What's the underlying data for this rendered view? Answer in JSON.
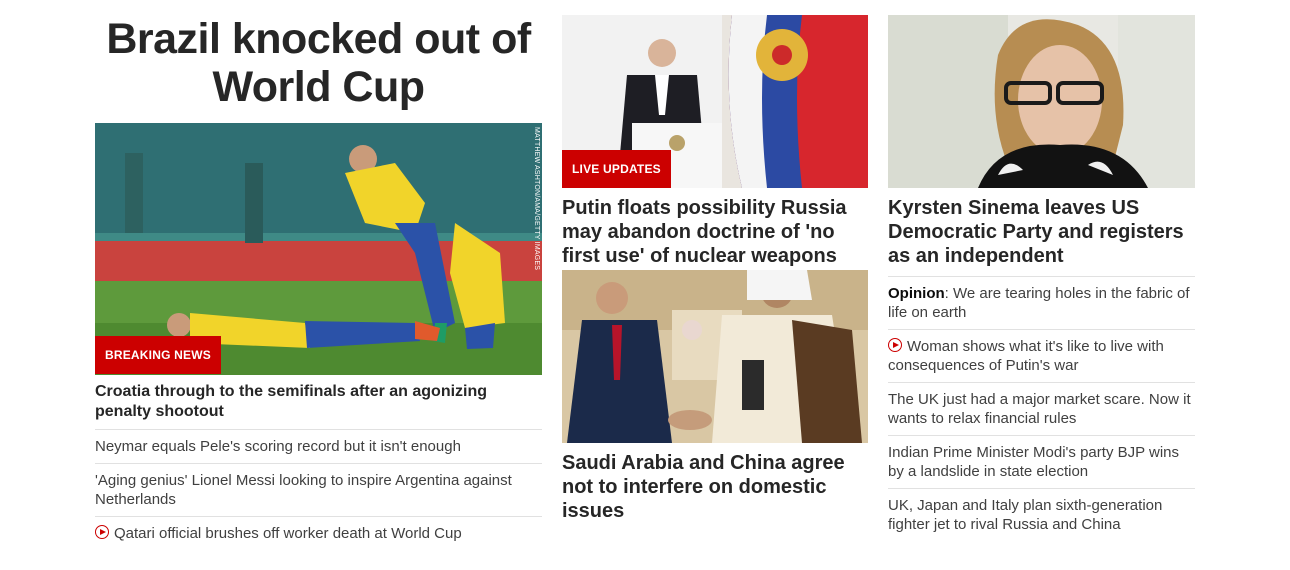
{
  "main_story": {
    "title": "Brazil knocked out of World Cup",
    "badge": "BREAKING NEWS",
    "image_credit": "MATTHEW ASHTON/AMA/GETTY IMAGES",
    "lead": "Croatia through to the semifinals after an agonizing penalty shootout",
    "related": [
      {
        "text": "Neymar equals Pele's scoring record but it isn't enough",
        "video": false
      },
      {
        "text": "'Aging genius' Lionel Messi looking to inspire Argentina against Netherlands",
        "video": false
      },
      {
        "text": "Qatari official brushes off worker death at World Cup",
        "video": true
      }
    ]
  },
  "putin_story": {
    "badge": "LIVE UPDATES",
    "headline": "Putin floats possibility Russia may abandon doctrine of 'no first use' of nuclear weapons"
  },
  "saudi_story": {
    "headline": "Saudi Arabia and China agree not to interfere on domestic issues"
  },
  "sinema_story": {
    "headline": "Kyrsten Sinema leaves US Democratic Party and registers as an independent",
    "list": [
      {
        "prefix": "Opinion",
        "text": ": We are tearing holes in the fabric of life on earth",
        "video": false
      },
      {
        "prefix": "",
        "text": "Woman shows what it's like to live with consequences of Putin's war",
        "video": true
      },
      {
        "prefix": "",
        "text": "The UK just had a major market scare. Now it wants to relax financial rules",
        "video": false
      },
      {
        "prefix": "",
        "text": "Indian Prime Minister Modi's party BJP wins by a landslide in state election",
        "video": false
      },
      {
        "prefix": "",
        "text": "UK, Japan and Italy plan sixth-generation fighter jet to rival Russia and China",
        "video": false
      }
    ]
  },
  "colors": {
    "badge_red": "#cc0000",
    "text": "#262626",
    "divider": "#e1e1e1"
  }
}
